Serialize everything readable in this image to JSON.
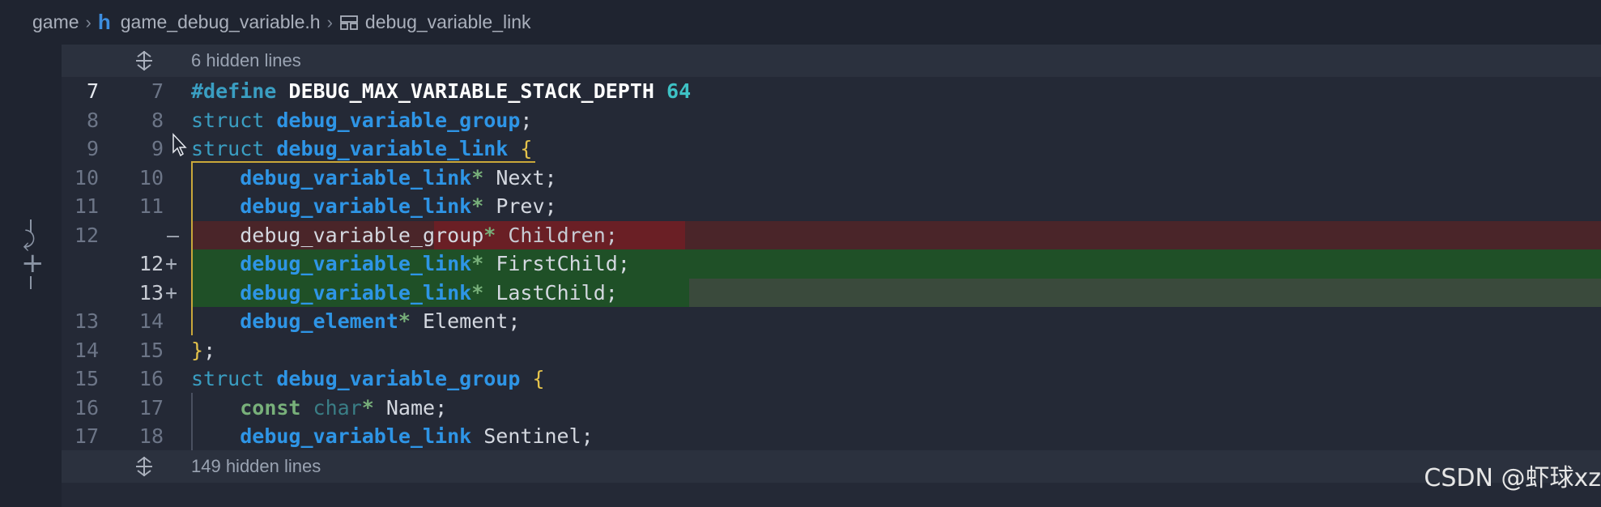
{
  "breadcrumb": {
    "folder": "game",
    "file_icon": "h",
    "file": "game_debug_variable.h",
    "symbol": "debug_variable_link"
  },
  "hidden_top": {
    "label": "6 hidden lines"
  },
  "hidden_bottom": {
    "label": "149 hidden lines"
  },
  "lines": [
    {
      "old": "7",
      "new": "7",
      "mark": ""
    },
    {
      "old": "8",
      "new": "8",
      "mark": ""
    },
    {
      "old": "9",
      "new": "9",
      "mark": ""
    },
    {
      "old": "10",
      "new": "10",
      "mark": ""
    },
    {
      "old": "11",
      "new": "11",
      "mark": ""
    },
    {
      "old": "12",
      "new": "",
      "mark": "—"
    },
    {
      "old": "",
      "new": "12",
      "mark": "+"
    },
    {
      "old": "",
      "new": "13",
      "mark": "+"
    },
    {
      "old": "13",
      "new": "14",
      "mark": ""
    },
    {
      "old": "14",
      "new": "15",
      "mark": ""
    },
    {
      "old": "15",
      "new": "16",
      "mark": ""
    },
    {
      "old": "16",
      "new": "17",
      "mark": ""
    },
    {
      "old": "17",
      "new": "18",
      "mark": ""
    }
  ],
  "code": {
    "l7": {
      "pp": "#define",
      "macro": "DEBUG_MAX_VARIABLE_STACK_DEPTH",
      "num": "64"
    },
    "l8": {
      "kw": "struct",
      "ty": "debug_variable_group",
      "rest": ";"
    },
    "l9": {
      "kw": "struct",
      "ty": "debug_variable_link",
      "brace": "{"
    },
    "l10": {
      "ty": "debug_variable_link",
      "star": "*",
      "rest": " Next;"
    },
    "l11": {
      "ty": "debug_variable_link",
      "star": "*",
      "rest": " Prev;"
    },
    "l12r": {
      "ty": "debug_variable_group",
      "star": "*",
      "rest": " Children",
      "semi": ";"
    },
    "l12a": {
      "ty": "debug_variable_link",
      "star": "*",
      "rest": " FirstChild;"
    },
    "l13a": {
      "ty": "debug_variable_link",
      "star": "*",
      "rest": " LastChild",
      "semi": ";"
    },
    "l14": {
      "ty": "debug_element",
      "star": "*",
      "rest": " Element;"
    },
    "l15": {
      "brace": "}",
      "rest": ";"
    },
    "l16": {
      "kw": "struct",
      "ty": "debug_variable_group",
      "brace": "{"
    },
    "l17": {
      "kw": "const",
      "ty": "char",
      "star": "*",
      "rest": " Name;"
    },
    "l18": {
      "ty": "debug_variable_link",
      "rest": " Sentinel;"
    }
  },
  "watermark": "CSDN @虾球xz",
  "colors": {
    "background": "#1f2430",
    "editor": "#242936",
    "removed": "#4a2529",
    "added": "#1f5027",
    "type": "#2e95e6",
    "keyword": "#3a9ec2",
    "brace": "#e5c34b"
  },
  "icons": [
    "file-h-icon",
    "symbol-struct-icon",
    "unfold-icon",
    "revert-icon",
    "add-icon",
    "mouse-cursor-icon"
  ]
}
